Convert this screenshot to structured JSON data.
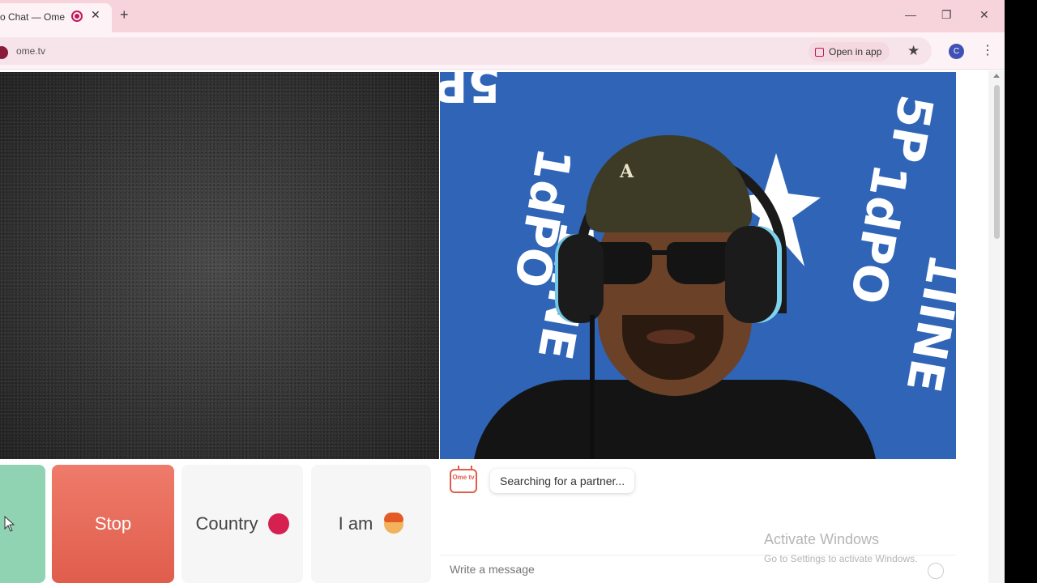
{
  "browser": {
    "tab_title": "o Chat — Ome",
    "tab_close": "✕",
    "new_tab": "+",
    "url": "ome.tv",
    "open_in_app": "Open in app",
    "profile_initial": "C",
    "window_controls": {
      "minimize": "—",
      "restore": "❐",
      "close": "✕"
    }
  },
  "controls": {
    "stop_label": "Stop",
    "country_label": "Country",
    "iam_label": "I am"
  },
  "chat": {
    "logo_text": "Ome tv",
    "status": "Searching for a partner...",
    "input_placeholder": "Write a message"
  },
  "watermark": {
    "title": "Activate Windows",
    "subtitle": "Go to Settings to activate Windows."
  },
  "video": {
    "cap_logo": "A",
    "flag_lines": [
      "5P",
      "1dPO",
      "1IINE"
    ]
  },
  "colors": {
    "tab_strip": "#f7d3dc",
    "stop_button": "#e05d4c",
    "start_button": "#8fd3b3",
    "flag_blue": "#2f64b7",
    "country_dot": "#d6204f"
  }
}
